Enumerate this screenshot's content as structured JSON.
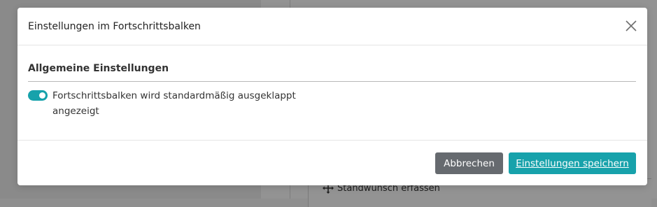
{
  "modal": {
    "title": "Einstellungen im Fortschrittsbalken",
    "close_icon": "close-icon",
    "section_title": "Allgemeine Einstellungen",
    "toggle": {
      "checked": true,
      "label": "Fortschrittsbalken wird standardmäßig ausgeklappt angezeigt"
    },
    "buttons": {
      "cancel_label": "Abbrechen",
      "save_label": "Einstellungen speichern"
    }
  },
  "background": {
    "card_label": "Standwunsch erfassen",
    "card_icon": "move-icon"
  },
  "colors": {
    "accent": "#17a2ab",
    "cancel_button": "#666a6f",
    "overlay": "#8f8f8f"
  }
}
